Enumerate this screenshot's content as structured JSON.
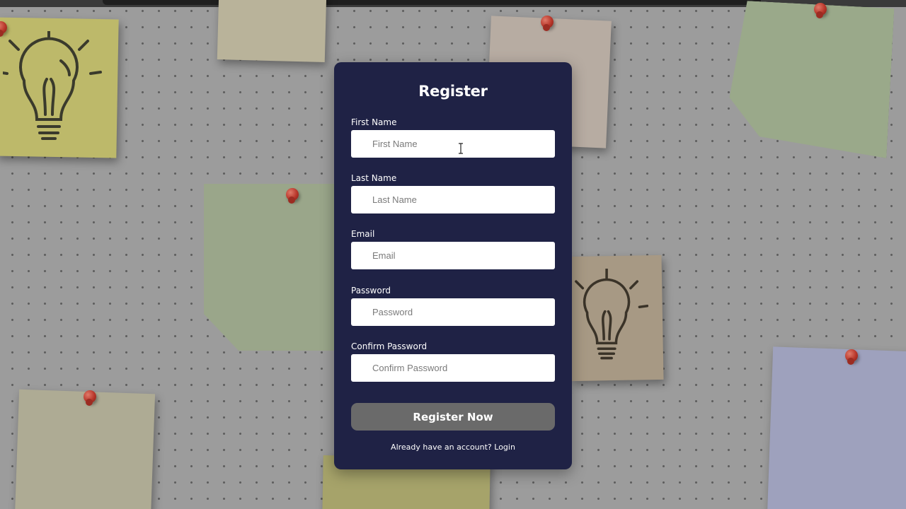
{
  "form": {
    "title": "Register",
    "fields": [
      {
        "label": "First Name",
        "placeholder": "First Name",
        "value": ""
      },
      {
        "label": "Last Name",
        "placeholder": "Last Name",
        "value": ""
      },
      {
        "label": "Email",
        "placeholder": "Email",
        "value": ""
      },
      {
        "label": "Password",
        "placeholder": "Password",
        "value": ""
      },
      {
        "label": "Confirm Password",
        "placeholder": "Confirm Password",
        "value": ""
      }
    ],
    "submit_label": "Register Now",
    "login_prompt": "Already have an account?",
    "login_link": "Login"
  },
  "background": {
    "board_color": "#9c9c9c",
    "dot_color": "#5e5e5e",
    "icons": [
      "lightbulb-icon",
      "pushpin-icon"
    ]
  },
  "colors": {
    "card": "#1f2245",
    "button": "#6a6a6a",
    "input": "#ffffff",
    "text": "#ffffff"
  }
}
